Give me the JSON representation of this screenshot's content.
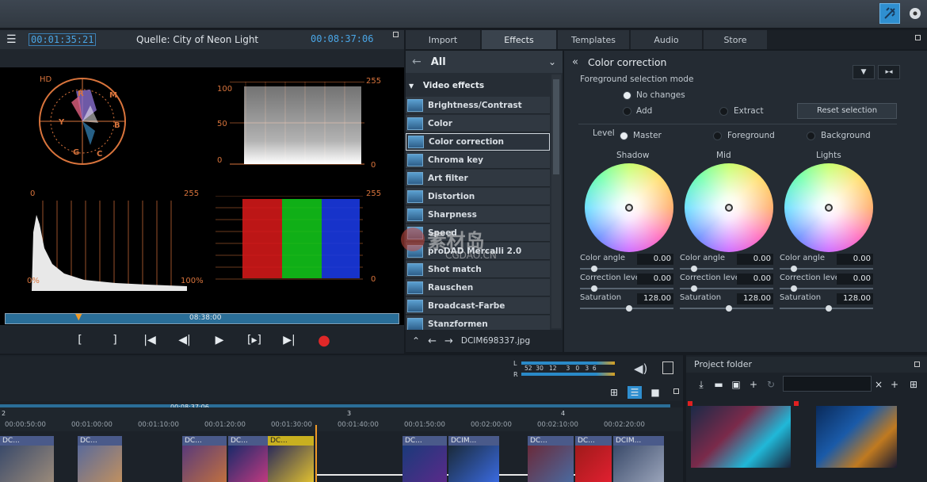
{
  "topbar": {
    "icons": [
      "magic-wand-icon",
      "disc-icon"
    ]
  },
  "monitor": {
    "current_time": "00:01:35:21",
    "source_label": "Quelle: City of Neon Light",
    "duration": "00:08:37:06",
    "timebar_label": "08:38:00",
    "vectorscope": {
      "hd": "HD",
      "letters": {
        "r": "R",
        "m": "M",
        "b": "B",
        "c": "C",
        "g": "G",
        "y": "Y"
      }
    },
    "waveform": {
      "left_ticks": [
        "100",
        "50",
        "0"
      ],
      "right_ticks": [
        "255",
        "0"
      ]
    },
    "histogram": {
      "top_left": "0",
      "top_right": "255",
      "bottom_left": "0%",
      "bottom_right": "100%"
    },
    "rgb_parade": {
      "top": "255",
      "bottom": "0"
    },
    "transport": [
      "[",
      "]",
      "|◀",
      "◀|",
      "▶",
      "[▸]",
      "▶|",
      "●"
    ]
  },
  "tabs": [
    {
      "label": "Import"
    },
    {
      "label": "Effects",
      "active": true
    },
    {
      "label": "Templates"
    },
    {
      "label": "Audio"
    },
    {
      "label": "Store"
    }
  ],
  "effects": {
    "filter": "All",
    "section": "Video effects",
    "items": [
      "Brightness/Contrast",
      "Color",
      "Color correction",
      "Chroma key",
      "Art filter",
      "Distortion",
      "Sharpness",
      "Speed",
      "proDAD Mercalli 2.0",
      "Shot match",
      "Rauschen",
      "Broadcast-Farbe",
      "Stanzformen"
    ],
    "selected": "Color correction",
    "footer_file": "DCIM698337.jpg"
  },
  "color_correction": {
    "title": "Color correction",
    "fg_mode_label": "Foreground selection mode",
    "no_changes": "No changes",
    "add": "Add",
    "extract": "Extract",
    "reset": "Reset selection",
    "level_label": "Level",
    "levels": [
      "Master",
      "Foreground",
      "Background"
    ],
    "wheels": [
      {
        "name": "Shadow",
        "color_angle": "0.00",
        "correction_level": "0.00",
        "saturation": "128.00"
      },
      {
        "name": "Mid",
        "color_angle": "0.00",
        "correction_level": "0.00",
        "saturation": "128.00"
      },
      {
        "name": "Lights",
        "color_angle": "0.00",
        "correction_level": "0.00",
        "saturation": "128.00"
      }
    ],
    "param_labels": {
      "color_angle": "Color angle",
      "correction_level": "Correction level",
      "saturation": "Saturation"
    }
  },
  "timeline": {
    "meter": {
      "l": "L",
      "r": "R",
      "scale": "52  30   12     3   0   3  6"
    },
    "total": "00:08:37:06",
    "markers": [
      "2",
      "3",
      "4"
    ],
    "ruler": [
      "00:00:50:00",
      "00:01:00:00",
      "00:01:10:00",
      "00:01:20:00",
      "00:01:30:00",
      "00:01:40:00",
      "00:01:50:00",
      "00:02:00:00",
      "00:02:10:00",
      "00:02:20:00"
    ],
    "clips": [
      "DC...",
      "DC...",
      "DC...",
      "DC...",
      "DC...",
      "DC...",
      "DCIM...",
      "DC...",
      "DC...",
      "DCIM..."
    ]
  },
  "project_folder": {
    "title": "Project folder",
    "search_placeholder": ""
  },
  "watermark": {
    "cn": "素材岛",
    "url": "CGDAO.CN"
  }
}
